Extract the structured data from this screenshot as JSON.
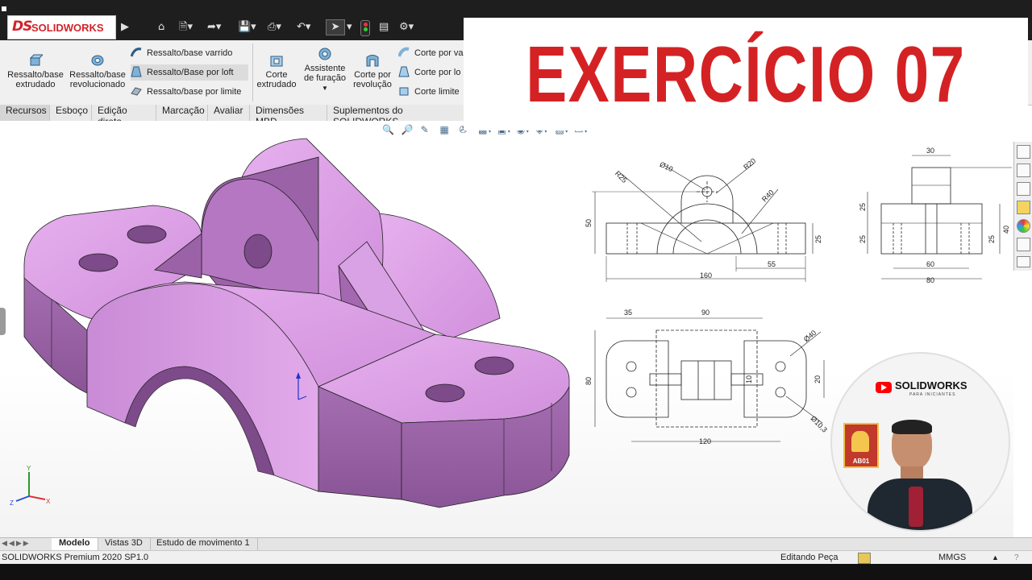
{
  "app": {
    "logo_text": "SOLIDWORKS",
    "logo_mark": "DS"
  },
  "quick_access": {
    "icons": [
      "home-icon",
      "new-document-icon",
      "open-icon",
      "save-icon",
      "print-icon",
      "undo-icon",
      "select-pointer-icon",
      "rebuild-traffic-light-icon",
      "file-properties-icon",
      "options-gear-icon"
    ]
  },
  "ribbon": {
    "big_buttons": [
      {
        "line1": "Ressalto/base",
        "line2": "extrudado",
        "icon": "extruded-boss-icon"
      },
      {
        "line1": "Ressalto/base",
        "line2": "revolucionado",
        "icon": "revolved-boss-icon"
      }
    ],
    "feature_rows": [
      {
        "label": "Ressalto/base varrido",
        "icon": "swept-boss-icon"
      },
      {
        "label": "Ressalto/Base por loft",
        "icon": "lofted-boss-icon"
      },
      {
        "label": "Ressalto/base por limite",
        "icon": "boundary-boss-icon"
      }
    ],
    "cut_buttons": [
      {
        "line1": "Corte",
        "line2": "extrudado",
        "icon": "extruded-cut-icon"
      },
      {
        "line1": "Assistente",
        "line2": "de furação",
        "icon": "hole-wizard-icon"
      },
      {
        "line1": "Corte por",
        "line2": "revolução",
        "icon": "revolved-cut-icon"
      }
    ],
    "cut_rows": [
      {
        "label": "Corte por va",
        "icon": "swept-cut-icon"
      },
      {
        "label": "Corte por lo",
        "icon": "lofted-cut-icon"
      },
      {
        "label": "Corte limite",
        "icon": "boundary-cut-icon"
      }
    ]
  },
  "command_tabs": [
    "Recursos",
    "Esboço",
    "Edição direta",
    "Marcação",
    "Avaliar",
    "Dimensões MBD",
    "Suplementos do SOLIDWORKS"
  ],
  "overlay_title": "EXERCÍCIO 07",
  "drawing": {
    "front_dims": {
      "r25": "R25",
      "d10": "Ø10",
      "r20": "R20",
      "r40": "R40",
      "h50": "50",
      "h25": "25",
      "w55": "55",
      "w160": "160"
    },
    "side_dims": {
      "w30": "30",
      "h25a": "25",
      "h25b": "25",
      "h25c": "25",
      "h40": "40",
      "w60": "60",
      "w80": "80"
    },
    "top_dims": {
      "w35": "35",
      "w90": "90",
      "d40": "Ø40",
      "h80": "80",
      "v10": "10",
      "v20": "20",
      "d103": "Ø10,3",
      "w120": "120"
    }
  },
  "channel_badge": {
    "brand": "SOLIDWORKS",
    "tagline": "PARA INICIANTES",
    "sticker": "AB01"
  },
  "bottom_tabs": [
    "Modelo",
    "Vistas 3D",
    "Estudo de movimento 1"
  ],
  "status": {
    "product": "SOLIDWORKS Premium 2020 SP1.0",
    "mode": "Editando Peça",
    "units": "MMGS"
  },
  "axes": {
    "x": "X",
    "y": "Y",
    "z": "Z"
  },
  "colors": {
    "part": "#d59be0",
    "title_red": "#d42224",
    "youtube_red": "#ff0000"
  }
}
